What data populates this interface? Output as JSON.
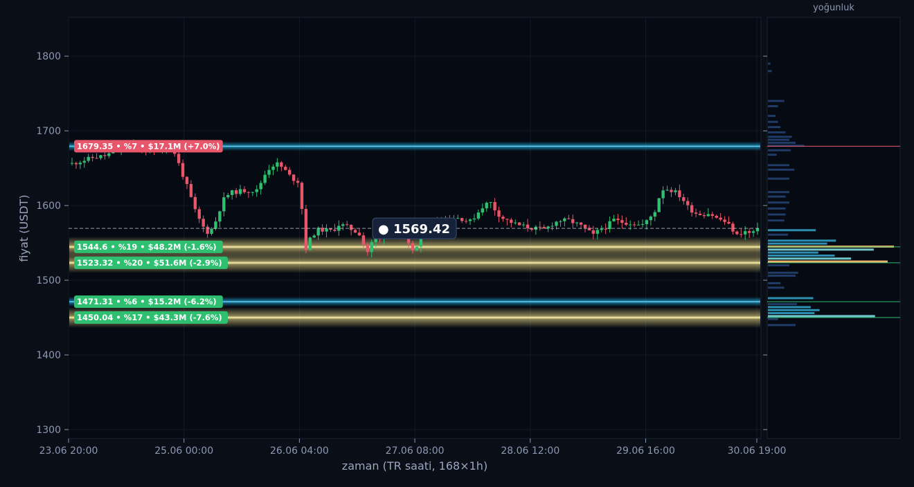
{
  "chart_data": {
    "type": "candlestick",
    "xlabel": "zaman (TR saati, 168×1h)",
    "ylabel": "fiyat (USDT)",
    "histogram_label": "yoğunluk",
    "ylim": [
      1288,
      1852
    ],
    "y_ticks": [
      "1300",
      "1400",
      "1500",
      "1600",
      "1700",
      "1800"
    ],
    "x_ticks": [
      "23.06 20:00",
      "25.06 00:00",
      "26.06 04:00",
      "27.06 08:00",
      "28.06 12:00",
      "29.06 16:00",
      "30.06 19:00"
    ],
    "candle_count": 168,
    "current_price": 1569.42,
    "current_price_label": "● 1569.42",
    "price_path": [
      [
        0,
        1656
      ],
      [
        6,
        1664
      ],
      [
        10,
        1667
      ],
      [
        14,
        1677
      ],
      [
        18,
        1680
      ],
      [
        22,
        1672
      ],
      [
        26,
        1676
      ],
      [
        28,
        1683
      ],
      [
        30,
        1670
      ],
      [
        32,
        1645
      ],
      [
        34,
        1620
      ],
      [
        36,
        1592
      ],
      [
        38,
        1573
      ],
      [
        40,
        1562
      ],
      [
        42,
        1580
      ],
      [
        44,
        1607
      ],
      [
        46,
        1617
      ],
      [
        50,
        1620
      ],
      [
        54,
        1620
      ],
      [
        56,
        1640
      ],
      [
        58,
        1653
      ],
      [
        60,
        1656
      ],
      [
        62,
        1648
      ],
      [
        64,
        1637
      ],
      [
        66,
        1632
      ],
      [
        67,
        1600
      ],
      [
        68,
        1540
      ],
      [
        70,
        1560
      ],
      [
        72,
        1568
      ],
      [
        74,
        1567
      ],
      [
        76,
        1566
      ],
      [
        78,
        1575
      ],
      [
        80,
        1572
      ],
      [
        82,
        1567
      ],
      [
        84,
        1562
      ],
      [
        86,
        1536
      ],
      [
        88,
        1555
      ],
      [
        90,
        1555
      ],
      [
        92,
        1575
      ],
      [
        94,
        1575
      ],
      [
        96,
        1560
      ],
      [
        98,
        1548
      ],
      [
        100,
        1538
      ],
      [
        102,
        1560
      ],
      [
        104,
        1566
      ],
      [
        106,
        1580
      ],
      [
        108,
        1580
      ],
      [
        112,
        1584
      ],
      [
        114,
        1582
      ],
      [
        116,
        1578
      ],
      [
        118,
        1588
      ],
      [
        120,
        1600
      ],
      [
        122,
        1605
      ],
      [
        124,
        1590
      ],
      [
        126,
        1582
      ],
      [
        130,
        1574
      ],
      [
        134,
        1570
      ],
      [
        138,
        1568
      ],
      [
        140,
        1575
      ],
      [
        142,
        1580
      ],
      [
        145,
        1580
      ],
      [
        148,
        1574
      ],
      [
        150,
        1568
      ],
      [
        152,
        1560
      ],
      [
        154,
        1568
      ],
      [
        156,
        1572
      ],
      [
        158,
        1581
      ],
      [
        160,
        1578
      ],
      [
        162,
        1577
      ],
      [
        164,
        1576
      ],
      [
        166,
        1573
      ],
      [
        168,
        1580
      ],
      [
        170,
        1592
      ],
      [
        172,
        1622
      ],
      [
        174,
        1622
      ],
      [
        176,
        1618
      ],
      [
        178,
        1610
      ],
      [
        180,
        1596
      ],
      [
        182,
        1590
      ],
      [
        184,
        1588
      ],
      [
        186,
        1590
      ],
      [
        188,
        1583
      ],
      [
        190,
        1580
      ],
      [
        192,
        1572
      ],
      [
        194,
        1560
      ],
      [
        196,
        1566
      ],
      [
        198,
        1562
      ],
      [
        200,
        1569.42
      ]
    ],
    "levels": [
      {
        "price": 1679.35,
        "kind": "resistance",
        "color": "#1ea8d8",
        "label": "1679.35 • %7 • $17.1M (+7.0%)"
      },
      {
        "price": 1544.6,
        "kind": "support",
        "color": "#f3e08a",
        "label": "1544.6 • %19 • $48.2M (-1.6%)"
      },
      {
        "price": 1523.32,
        "kind": "support",
        "color": "#f3e08a",
        "label": "1523.32 • %20 • $51.6M (-2.9%)"
      },
      {
        "price": 1471.31,
        "kind": "support",
        "color": "#1ea8d8",
        "label": "1471.31 • %6 • $15.2M (-6.2%)"
      },
      {
        "price": 1450.04,
        "kind": "support",
        "color": "#f3e08a",
        "label": "1450.04 • %17 • $43.3M (-7.6%)"
      }
    ],
    "colors": {
      "up": "#2fbf71",
      "down": "#e8566c",
      "resistance_tag": "#e8566c",
      "support_tag": "#2fbf71",
      "background": "#060a12",
      "grid": "#141b28"
    },
    "density_histogram": [
      {
        "price": 1790,
        "density": 0.02
      },
      {
        "price": 1780,
        "density": 0.03
      },
      {
        "price": 1740,
        "density": 0.13
      },
      {
        "price": 1733,
        "density": 0.08
      },
      {
        "price": 1720,
        "density": 0.06
      },
      {
        "price": 1712,
        "density": 0.08
      },
      {
        "price": 1705,
        "density": 0.1
      },
      {
        "price": 1698,
        "density": 0.14
      },
      {
        "price": 1692,
        "density": 0.19
      },
      {
        "price": 1688,
        "density": 0.17
      },
      {
        "price": 1684,
        "density": 0.22
      },
      {
        "price": 1680,
        "density": 0.29
      },
      {
        "price": 1674,
        "density": 0.18
      },
      {
        "price": 1668,
        "density": 0.07
      },
      {
        "price": 1654,
        "density": 0.17
      },
      {
        "price": 1648,
        "density": 0.21
      },
      {
        "price": 1636,
        "density": 0.17
      },
      {
        "price": 1618,
        "density": 0.17
      },
      {
        "price": 1612,
        "density": 0.14
      },
      {
        "price": 1604,
        "density": 0.17
      },
      {
        "price": 1596,
        "density": 0.14
      },
      {
        "price": 1588,
        "density": 0.14
      },
      {
        "price": 1580,
        "density": 0.13
      },
      {
        "price": 1567,
        "density": 0.38
      },
      {
        "price": 1561,
        "density": 0.16
      },
      {
        "price": 1553,
        "density": 0.54
      },
      {
        "price": 1549,
        "density": 0.47
      },
      {
        "price": 1545,
        "density": 1.0
      },
      {
        "price": 1541,
        "density": 0.84
      },
      {
        "price": 1537,
        "density": 0.4
      },
      {
        "price": 1533,
        "density": 0.53
      },
      {
        "price": 1529,
        "density": 0.66
      },
      {
        "price": 1525,
        "density": 0.95
      },
      {
        "price": 1520,
        "density": 0.17
      },
      {
        "price": 1510,
        "density": 0.24
      },
      {
        "price": 1506,
        "density": 0.22
      },
      {
        "price": 1496,
        "density": 0.1
      },
      {
        "price": 1490,
        "density": 0.13
      },
      {
        "price": 1476,
        "density": 0.36
      },
      {
        "price": 1468,
        "density": 0.23
      },
      {
        "price": 1464,
        "density": 0.34
      },
      {
        "price": 1460,
        "density": 0.41
      },
      {
        "price": 1456,
        "density": 0.37
      },
      {
        "price": 1452,
        "density": 0.85
      },
      {
        "price": 1448,
        "density": 0.08
      },
      {
        "price": 1440,
        "density": 0.22
      }
    ]
  }
}
